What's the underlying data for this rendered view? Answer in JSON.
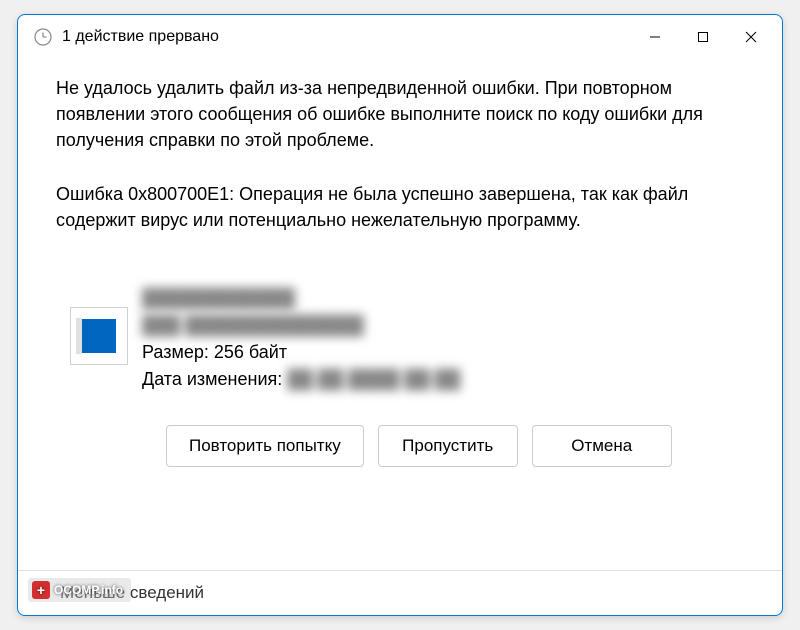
{
  "titlebar": {
    "title": "1 действие прервано"
  },
  "content": {
    "message": "Не удалось удалить файл из-за непредвиденной ошибки. При повторном появлении этого сообщения об ошибке выполните поиск по коду ошибки для получения справки по этой проблеме.",
    "error_line": "Ошибка 0x800700E1: Операция не была успешно завершена, так как файл содержит вирус или потенциально нежелательную программу."
  },
  "file": {
    "name_blurred": "████████████",
    "type_blurred": "███ ██████████████",
    "size_label": "Размер: 256 байт",
    "date_label": "Дата изменения:",
    "date_value_blurred": "██.██.████ ██:██"
  },
  "buttons": {
    "retry": "Повторить попытку",
    "skip": "Пропустить",
    "cancel": "Отмена"
  },
  "footer": {
    "less_details": "Меньше сведений"
  },
  "watermark": {
    "text": "OCOMP.info"
  }
}
